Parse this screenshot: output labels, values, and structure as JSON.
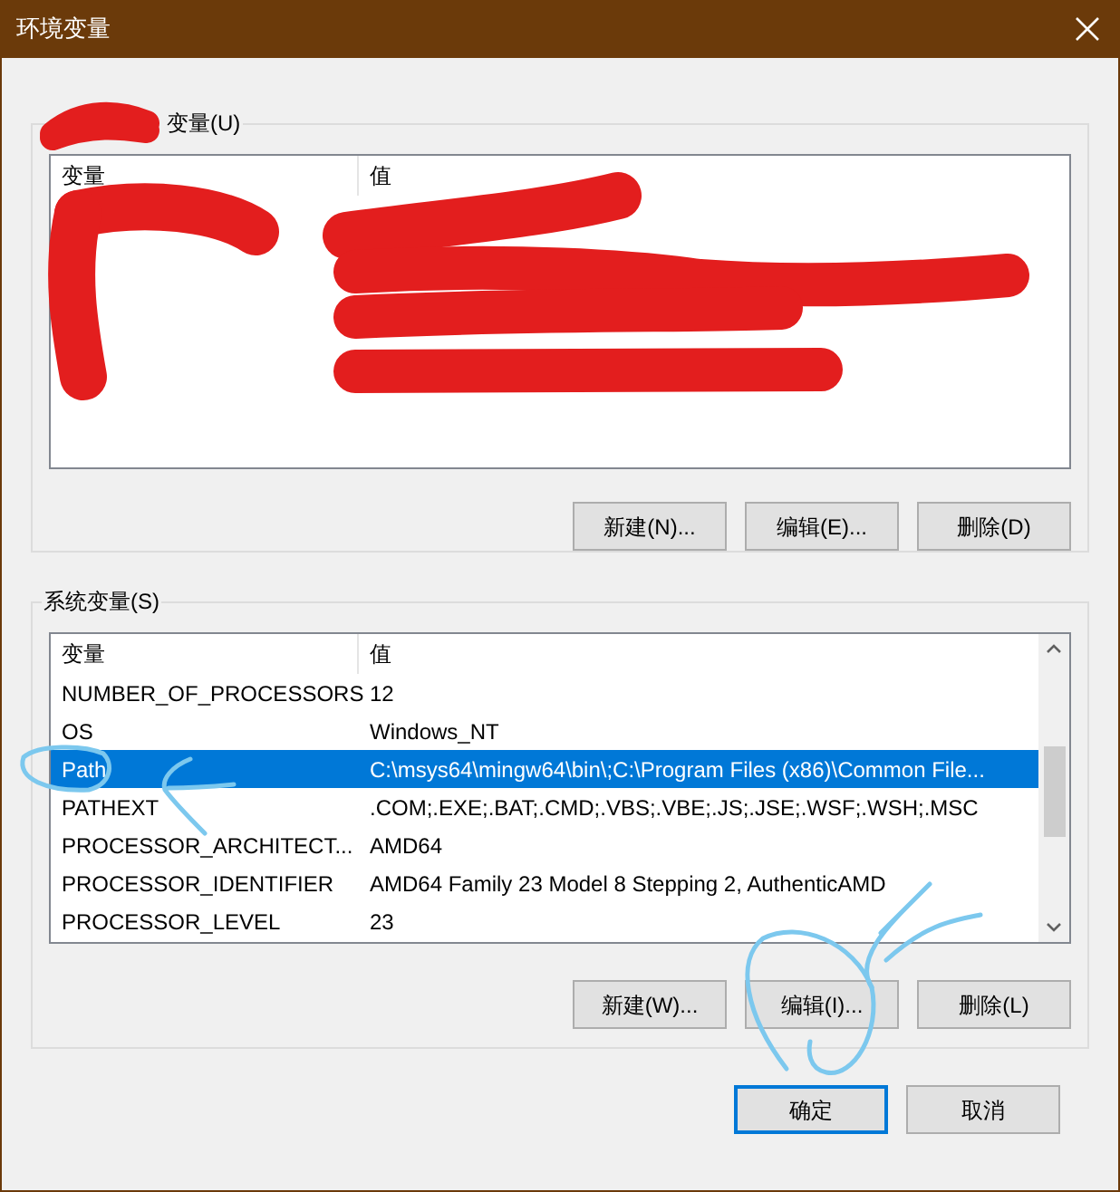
{
  "window": {
    "title": "环境变量"
  },
  "user_variables": {
    "label": "变量(U)",
    "columns": [
      "变量",
      "值"
    ]
  },
  "user_buttons": [
    "新建(N)...",
    "编辑(E)...",
    "删除(D)"
  ],
  "system_variables": {
    "label": "系统变量(S)",
    "columns": [
      "变量",
      "值"
    ],
    "rows": [
      {
        "name": "NUMBER_OF_PROCESSORS",
        "value": "12",
        "selected": false
      },
      {
        "name": "OS",
        "value": "Windows_NT",
        "selected": false
      },
      {
        "name": "Path",
        "value": "C:\\msys64\\mingw64\\bin\\;C:\\Program Files (x86)\\Common File...",
        "selected": true
      },
      {
        "name": "PATHEXT",
        "value": ".COM;.EXE;.BAT;.CMD;.VBS;.VBE;.JS;.JSE;.WSF;.WSH;.MSC",
        "selected": false
      },
      {
        "name": "PROCESSOR_ARCHITECT...",
        "value": "AMD64",
        "selected": false
      },
      {
        "name": "PROCESSOR_IDENTIFIER",
        "value": "AMD64 Family 23 Model 8 Stepping 2, AuthenticAMD",
        "selected": false
      },
      {
        "name": "PROCESSOR_LEVEL",
        "value": "23",
        "selected": false
      }
    ]
  },
  "system_buttons": [
    "新建(W)...",
    "编辑(I)...",
    "删除(L)"
  ],
  "dialog_buttons": [
    {
      "label": "确定",
      "default": true
    },
    {
      "label": "取消",
      "default": false
    }
  ]
}
